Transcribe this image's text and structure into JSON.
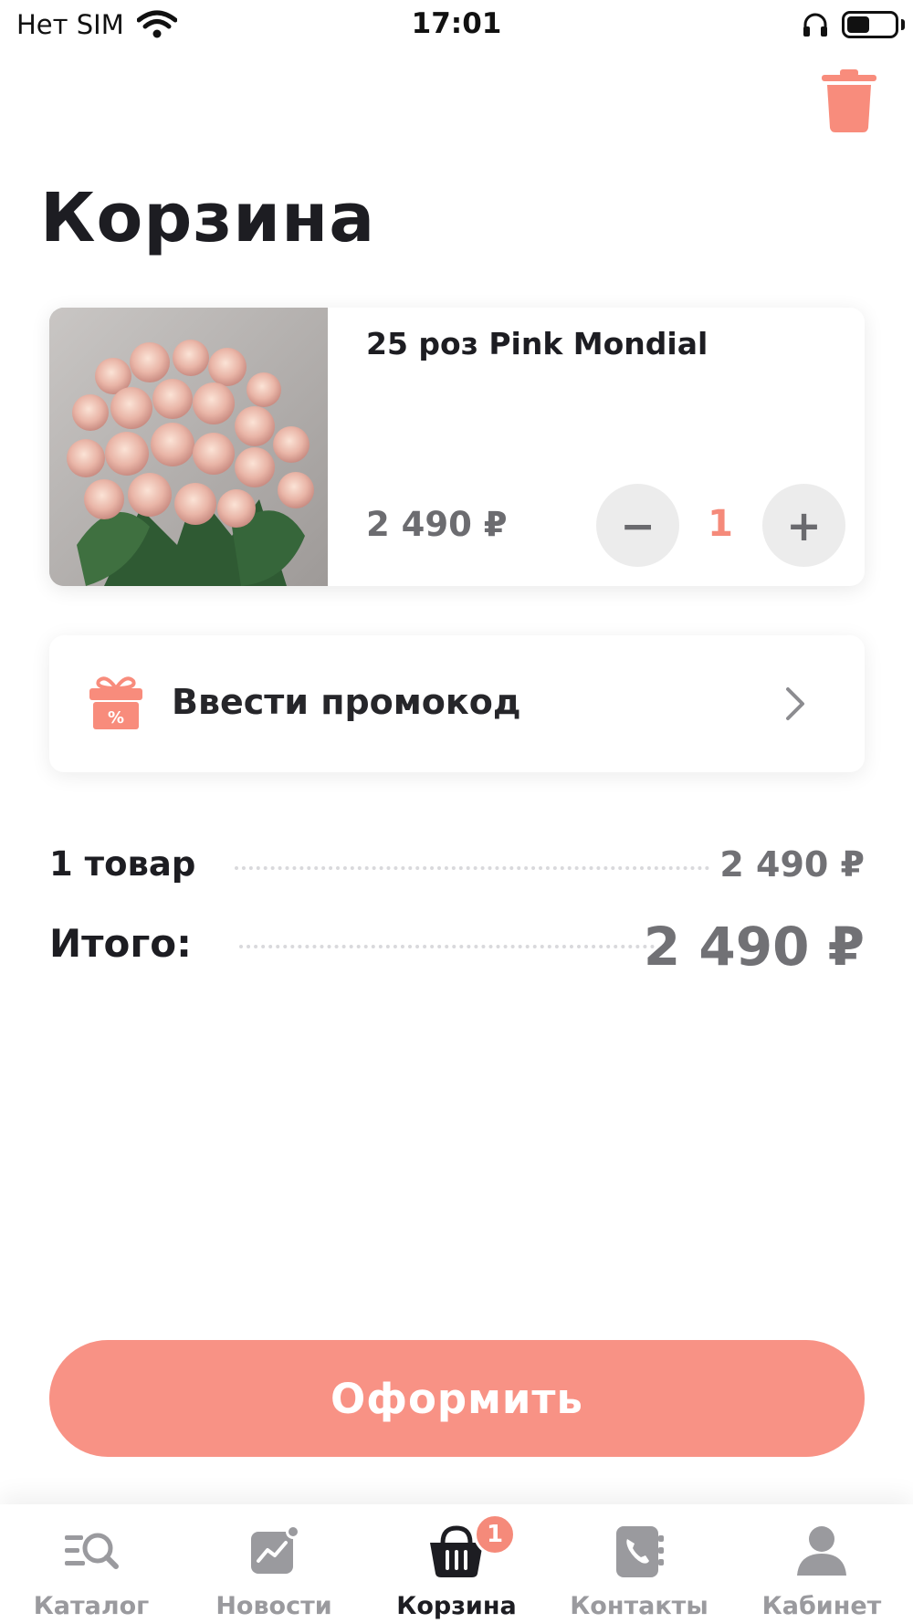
{
  "status_bar": {
    "carrier": "Нет SIM",
    "time": "17:01"
  },
  "header": {
    "title": "Корзина",
    "trash_icon": "trash-icon"
  },
  "cart_item": {
    "name": "25 роз Pink Mondial",
    "price": "2 490 ₽",
    "quantity": "1",
    "minus_label": "−",
    "plus_label": "+"
  },
  "promo": {
    "label": "Ввести промокод",
    "icon": "gift-percent-icon"
  },
  "summary": {
    "items_label": "1 товар",
    "items_value": "2 490 ₽",
    "total_label": "Итого:",
    "total_value": "2 490 ₽"
  },
  "checkout": {
    "label": "Оформить"
  },
  "tab_bar": {
    "tabs": [
      {
        "label": "Каталог",
        "icon": "catalog-search-icon"
      },
      {
        "label": "Новости",
        "icon": "news-chart-icon"
      },
      {
        "label": "Корзина",
        "icon": "basket-icon",
        "badge": "1",
        "active": true
      },
      {
        "label": "Контакты",
        "icon": "contacts-phone-icon"
      },
      {
        "label": "Кабинет",
        "icon": "user-icon"
      }
    ]
  },
  "colors": {
    "accent": "#f89285",
    "accent_text": "#f58a7a",
    "inactive": "#9a9a9e"
  }
}
